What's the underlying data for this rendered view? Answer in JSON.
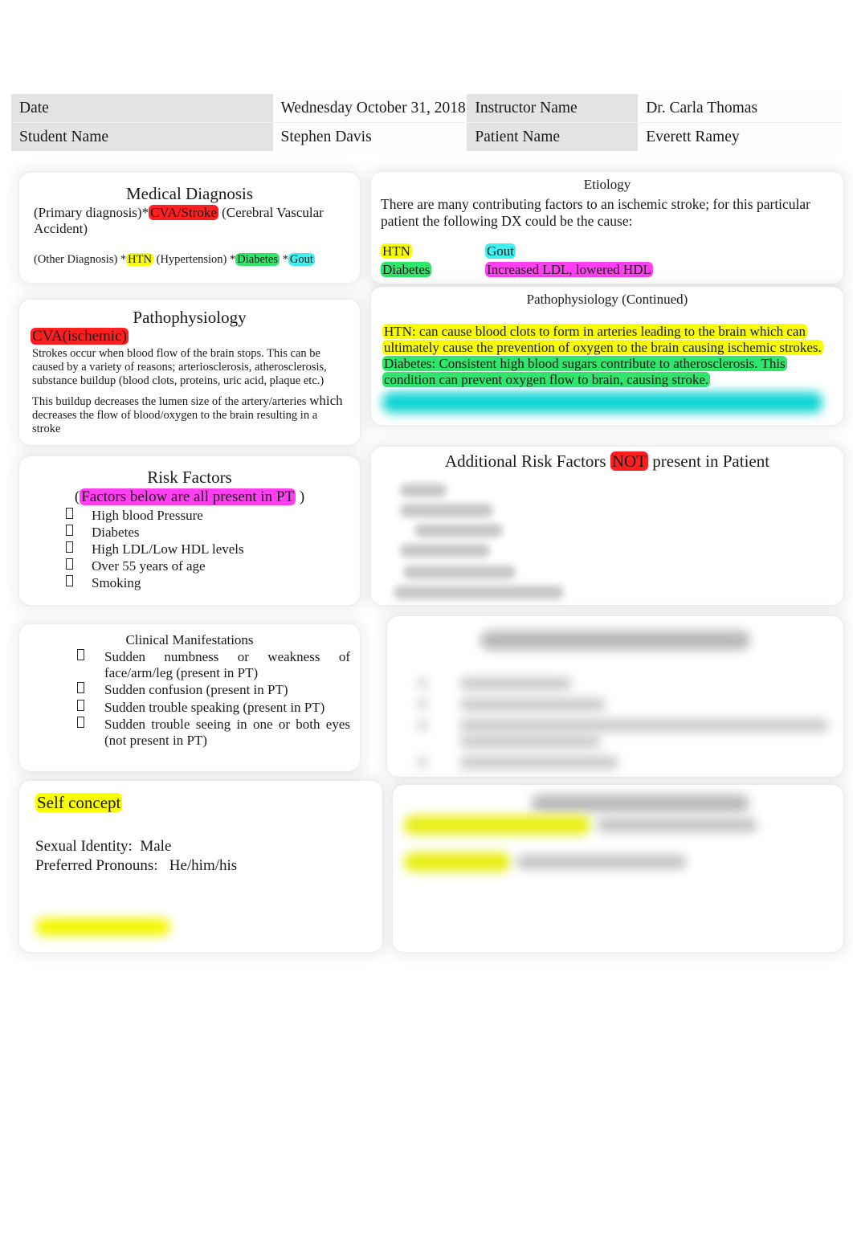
{
  "header": {
    "rows": [
      {
        "label1": "Date",
        "value1": "Wednesday October 31, 2018",
        "label2": "Instructor Name",
        "value2": "Dr. Carla Thomas"
      },
      {
        "label1": "Student Name",
        "value1": "Stephen Davis",
        "label2": "Patient Name",
        "value2": "Everett Ramey"
      }
    ]
  },
  "medical_diagnosis": {
    "title": "Medical Diagnosis",
    "primary_prefix": "(Primary  diagnosis)*",
    "primary_highlight": "CVA/Stroke",
    "primary_suffix": "  (Cerebral Vascular Accident)",
    "other_prefix": "(Other  Diagnosis) *",
    "other_htn": "HTN",
    "other_htn_suffix": " (Hypertension) *",
    "other_diabetes": "Diabetes",
    "other_mid": " *",
    "other_gout": "Gout"
  },
  "etiology": {
    "title": "Etiology",
    "intro": "There are many contributing factors to an ischemic stroke; for this particular patient the following DX could be the cause:",
    "col1": [
      {
        "text": "HTN",
        "highlight": "yellow"
      },
      {
        "text": "Diabetes",
        "highlight": "green"
      }
    ],
    "col2": [
      {
        "text": "Gout",
        "highlight": "cyan"
      },
      {
        "text": "Increased LDL, lowered HDL",
        "highlight": "magenta"
      }
    ]
  },
  "pathophysiology": {
    "title": "Pathophysiology",
    "subtitle_highlight": "CVA(ischemic)",
    "para1": "Strokes occur when blood flow of the brain stops.  This can be caused by a variety of reasons; arteriosclerosis, atherosclerosis, substance buildup (blood clots, proteins, uric acid, plaque etc.)",
    "para2a": "This buildup decreases the lumen size of the artery/arteries ",
    "para2b": "which",
    "para2c": "decreases the flow of blood/oxygen to the brain resulting in a stroke"
  },
  "pathophysiology_continued": {
    "title": "Pathophysiology (Continued)",
    "htn_line": "HTN: can cause blood clots to form in arteries leading to the brain which can ultimately cause the prevention of oxygen to the brain causing ischemic strokes.",
    "diabetes_line": "Diabetes:  Consistent high blood sugars contribute to atherosclerosis.  This condition can prevent oxygen flow to brain, causing stroke.",
    "redacted_line": ""
  },
  "risk_factors": {
    "title": "Risk Factors",
    "subtitle_open": "(",
    "subtitle_highlight": "Factors below are all present in PT",
    "subtitle_close": " )",
    "items": [
      "High blood Pressure",
      "Diabetes",
      "High LDL/Low HDL levels",
      "Over 55 years of age",
      "Smoking"
    ]
  },
  "additional_risk_factors": {
    "title_prefix": "Additional Risk Factors  ",
    "title_highlight": "NOT",
    "title_suffix": " present in Patient",
    "items": [
      "",
      "",
      "",
      "",
      "",
      ""
    ]
  },
  "clinical_manifestations": {
    "title": "Clinical Manifestations",
    "items": [
      "Sudden numbness or weakness of face/arm/leg (present in PT)",
      "Sudden confusion (present in PT)",
      "Sudden trouble speaking (present in PT)",
      "Sudden trouble seeing in one or both eyes (not present in PT)"
    ]
  },
  "clinical_manifestations_continued": {
    "title": "",
    "items": [
      "",
      "",
      "",
      ""
    ]
  },
  "self_concept": {
    "title_highlight": "Self concept",
    "sexual_identity_label": "Sexual Identity:",
    "sexual_identity_value": "Male",
    "preferred_pronouns_label": "Preferred Pronouns:",
    "preferred_pronouns_value": "He/him/his",
    "redacted_line": ""
  },
  "psychosocial": {
    "title": "",
    "lines": [
      "",
      ""
    ]
  },
  "colors": {
    "highlight_red": "#ff1f1f",
    "highlight_yellow": "#faff00",
    "highlight_green": "#2fe56a",
    "highlight_cyan": "#3ef0f0",
    "highlight_magenta": "#ff3ff0",
    "header_label_bg": "#e3e3e3",
    "page_bg": "#ffffff"
  }
}
